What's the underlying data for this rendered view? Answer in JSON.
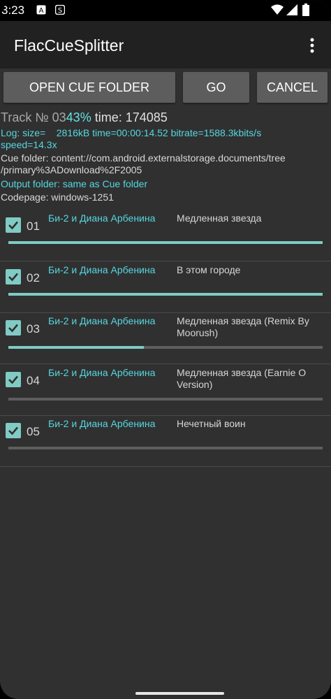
{
  "status_bar": {
    "time": "3:23",
    "left_icons": [
      "a-badge-icon",
      "s-badge-icon"
    ],
    "right_icons": [
      "wifi-icon",
      "signal-icon",
      "battery-icon"
    ]
  },
  "app_bar": {
    "title": "FlacCueSplitter",
    "menu_icon": "more-vert-icon"
  },
  "buttons": {
    "open": "OPEN CUE FOLDER",
    "go": "GO",
    "cancel": "CANCEL"
  },
  "info": {
    "track_label": "Track № 03",
    "percent": "43%",
    "time_label": " time: 174085",
    "log_line1": "Log: size=    2816kB time=00:00:14.52 bitrate=1588.3kbits/s",
    "log_line2": "speed=14.3x",
    "cue_line1": "Cue folder: content://com.android.externalstorage.documents/tree",
    "cue_line2": "/primary%3ADownload%2F2005",
    "output": "Output folder: same as Cue folder",
    "codepage": "Codepage: windows-1251"
  },
  "tracks": [
    {
      "num": "01",
      "artist": "Би-2 и Диана Арбенина",
      "title": "Медленная звезда",
      "checked": true,
      "progress": 1.0
    },
    {
      "num": "02",
      "artist": "Би-2 и Диана Арбенина",
      "title": "В этом городе",
      "checked": true,
      "progress": 1.0
    },
    {
      "num": "03",
      "artist": "Би-2 и Диана Арбенина",
      "title": "Медленная звезда (Remix By Moorush)",
      "checked": true,
      "progress": 0.43
    },
    {
      "num": "04",
      "artist": "Би-2 и Диана Арбенина",
      "title": "Медленная звезда (Earnie O Version)",
      "checked": true,
      "progress": 0.0
    },
    {
      "num": "05",
      "artist": "Би-2 и Диана Арбенина",
      "title": "Нечетный воин",
      "checked": true,
      "progress": 0.0
    }
  ],
  "colors": {
    "accent": "#80cbc4",
    "cyan_text": "#56d7e0",
    "background": "#303030",
    "app_bar": "#212121"
  }
}
